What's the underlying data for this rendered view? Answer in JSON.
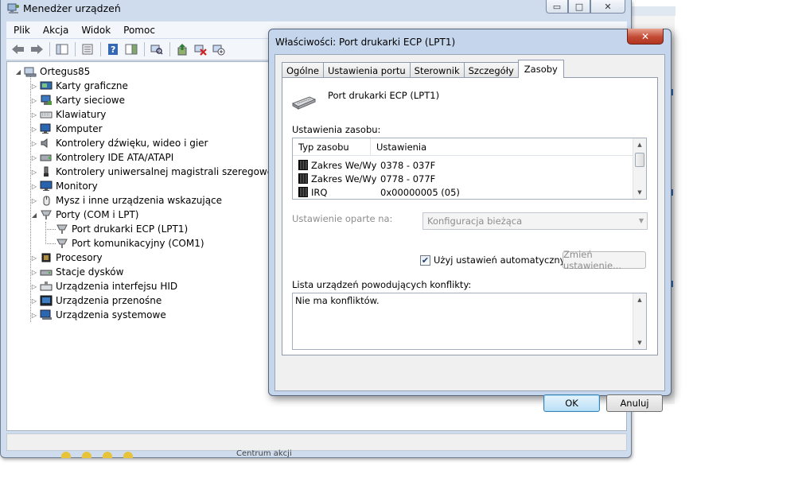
{
  "device_manager": {
    "title": "Menedżer urządzeń",
    "caption_buttons": {
      "minimize": "▭",
      "maximize": "□",
      "close": "✕"
    },
    "menu": [
      "Plik",
      "Akcja",
      "Widok",
      "Pomoc"
    ],
    "toolbar_icons": [
      "back-icon",
      "forward-icon",
      "show-hide-tree-icon",
      "properties-icon",
      "help-icon",
      "action-pane-icon",
      "scan-hardware-icon",
      "update-driver-icon",
      "uninstall-icon",
      "disable-icon"
    ],
    "tree": {
      "root": "Ortegus85",
      "items": [
        {
          "label": "Karty graficzne",
          "icon": "display-adapter-icon"
        },
        {
          "label": "Karty sieciowe",
          "icon": "network-adapter-icon"
        },
        {
          "label": "Klawiatury",
          "icon": "keyboard-icon"
        },
        {
          "label": "Komputer",
          "icon": "computer-icon"
        },
        {
          "label": "Kontrolery dźwięku, wideo i gier",
          "icon": "speaker-icon"
        },
        {
          "label": "Kontrolery IDE ATA/ATAPI",
          "icon": "ide-controller-icon"
        },
        {
          "label": "Kontrolery uniwersalnej magistrali szeregowej",
          "icon": "usb-icon"
        },
        {
          "label": "Monitory",
          "icon": "monitor-icon"
        },
        {
          "label": "Mysz i inne urządzenia wskazujące",
          "icon": "mouse-icon"
        },
        {
          "label": "Porty (COM i LPT)",
          "icon": "port-icon",
          "expanded": true,
          "children": [
            "Port drukarki ECP (LPT1)",
            "Port komunikacyjny (COM1)"
          ]
        },
        {
          "label": "Procesory",
          "icon": "processor-icon"
        },
        {
          "label": "Stacje dysków",
          "icon": "disk-drive-icon"
        },
        {
          "label": "Urządzenia interfejsu HID",
          "icon": "hid-icon"
        },
        {
          "label": "Urządzenia przenośne",
          "icon": "portable-device-icon"
        },
        {
          "label": "Urządzenia systemowe",
          "icon": "system-device-icon"
        }
      ]
    },
    "behind_text": "Centrum akcji"
  },
  "dialog": {
    "title": "Właściwości: Port drukarki ECP (LPT1)",
    "close": "✕",
    "tabs": [
      "Ogólne",
      "Ustawienia portu",
      "Sterownik",
      "Szczegóły",
      "Zasoby"
    ],
    "active_tab": "Zasoby",
    "device_name": "Port drukarki ECP (LPT1)",
    "resources_label": "Ustawienia zasobu:",
    "resources_columns": [
      "Typ zasobu",
      "Ustawienia"
    ],
    "resources_rows": [
      {
        "type": "Zakres We/Wy",
        "setting": "0378 - 037F"
      },
      {
        "type": "Zakres We/Wy",
        "setting": "0778 - 077F"
      },
      {
        "type": "IRQ",
        "setting": "0x00000005 (05)"
      }
    ],
    "based_on_label": "Ustawienie oparte na:",
    "based_on_value": "Konfiguracja bieżąca",
    "auto_settings_label": "Użyj ustawień automatycznych",
    "auto_settings_checked": true,
    "change_setting_button": "Zmień ustawienie...",
    "conflicts_label": "Lista urządzeń powodujących konflikty:",
    "conflicts_text": "Nie ma konfliktów.",
    "ok_button": "OK",
    "cancel_button": "Anuluj"
  }
}
